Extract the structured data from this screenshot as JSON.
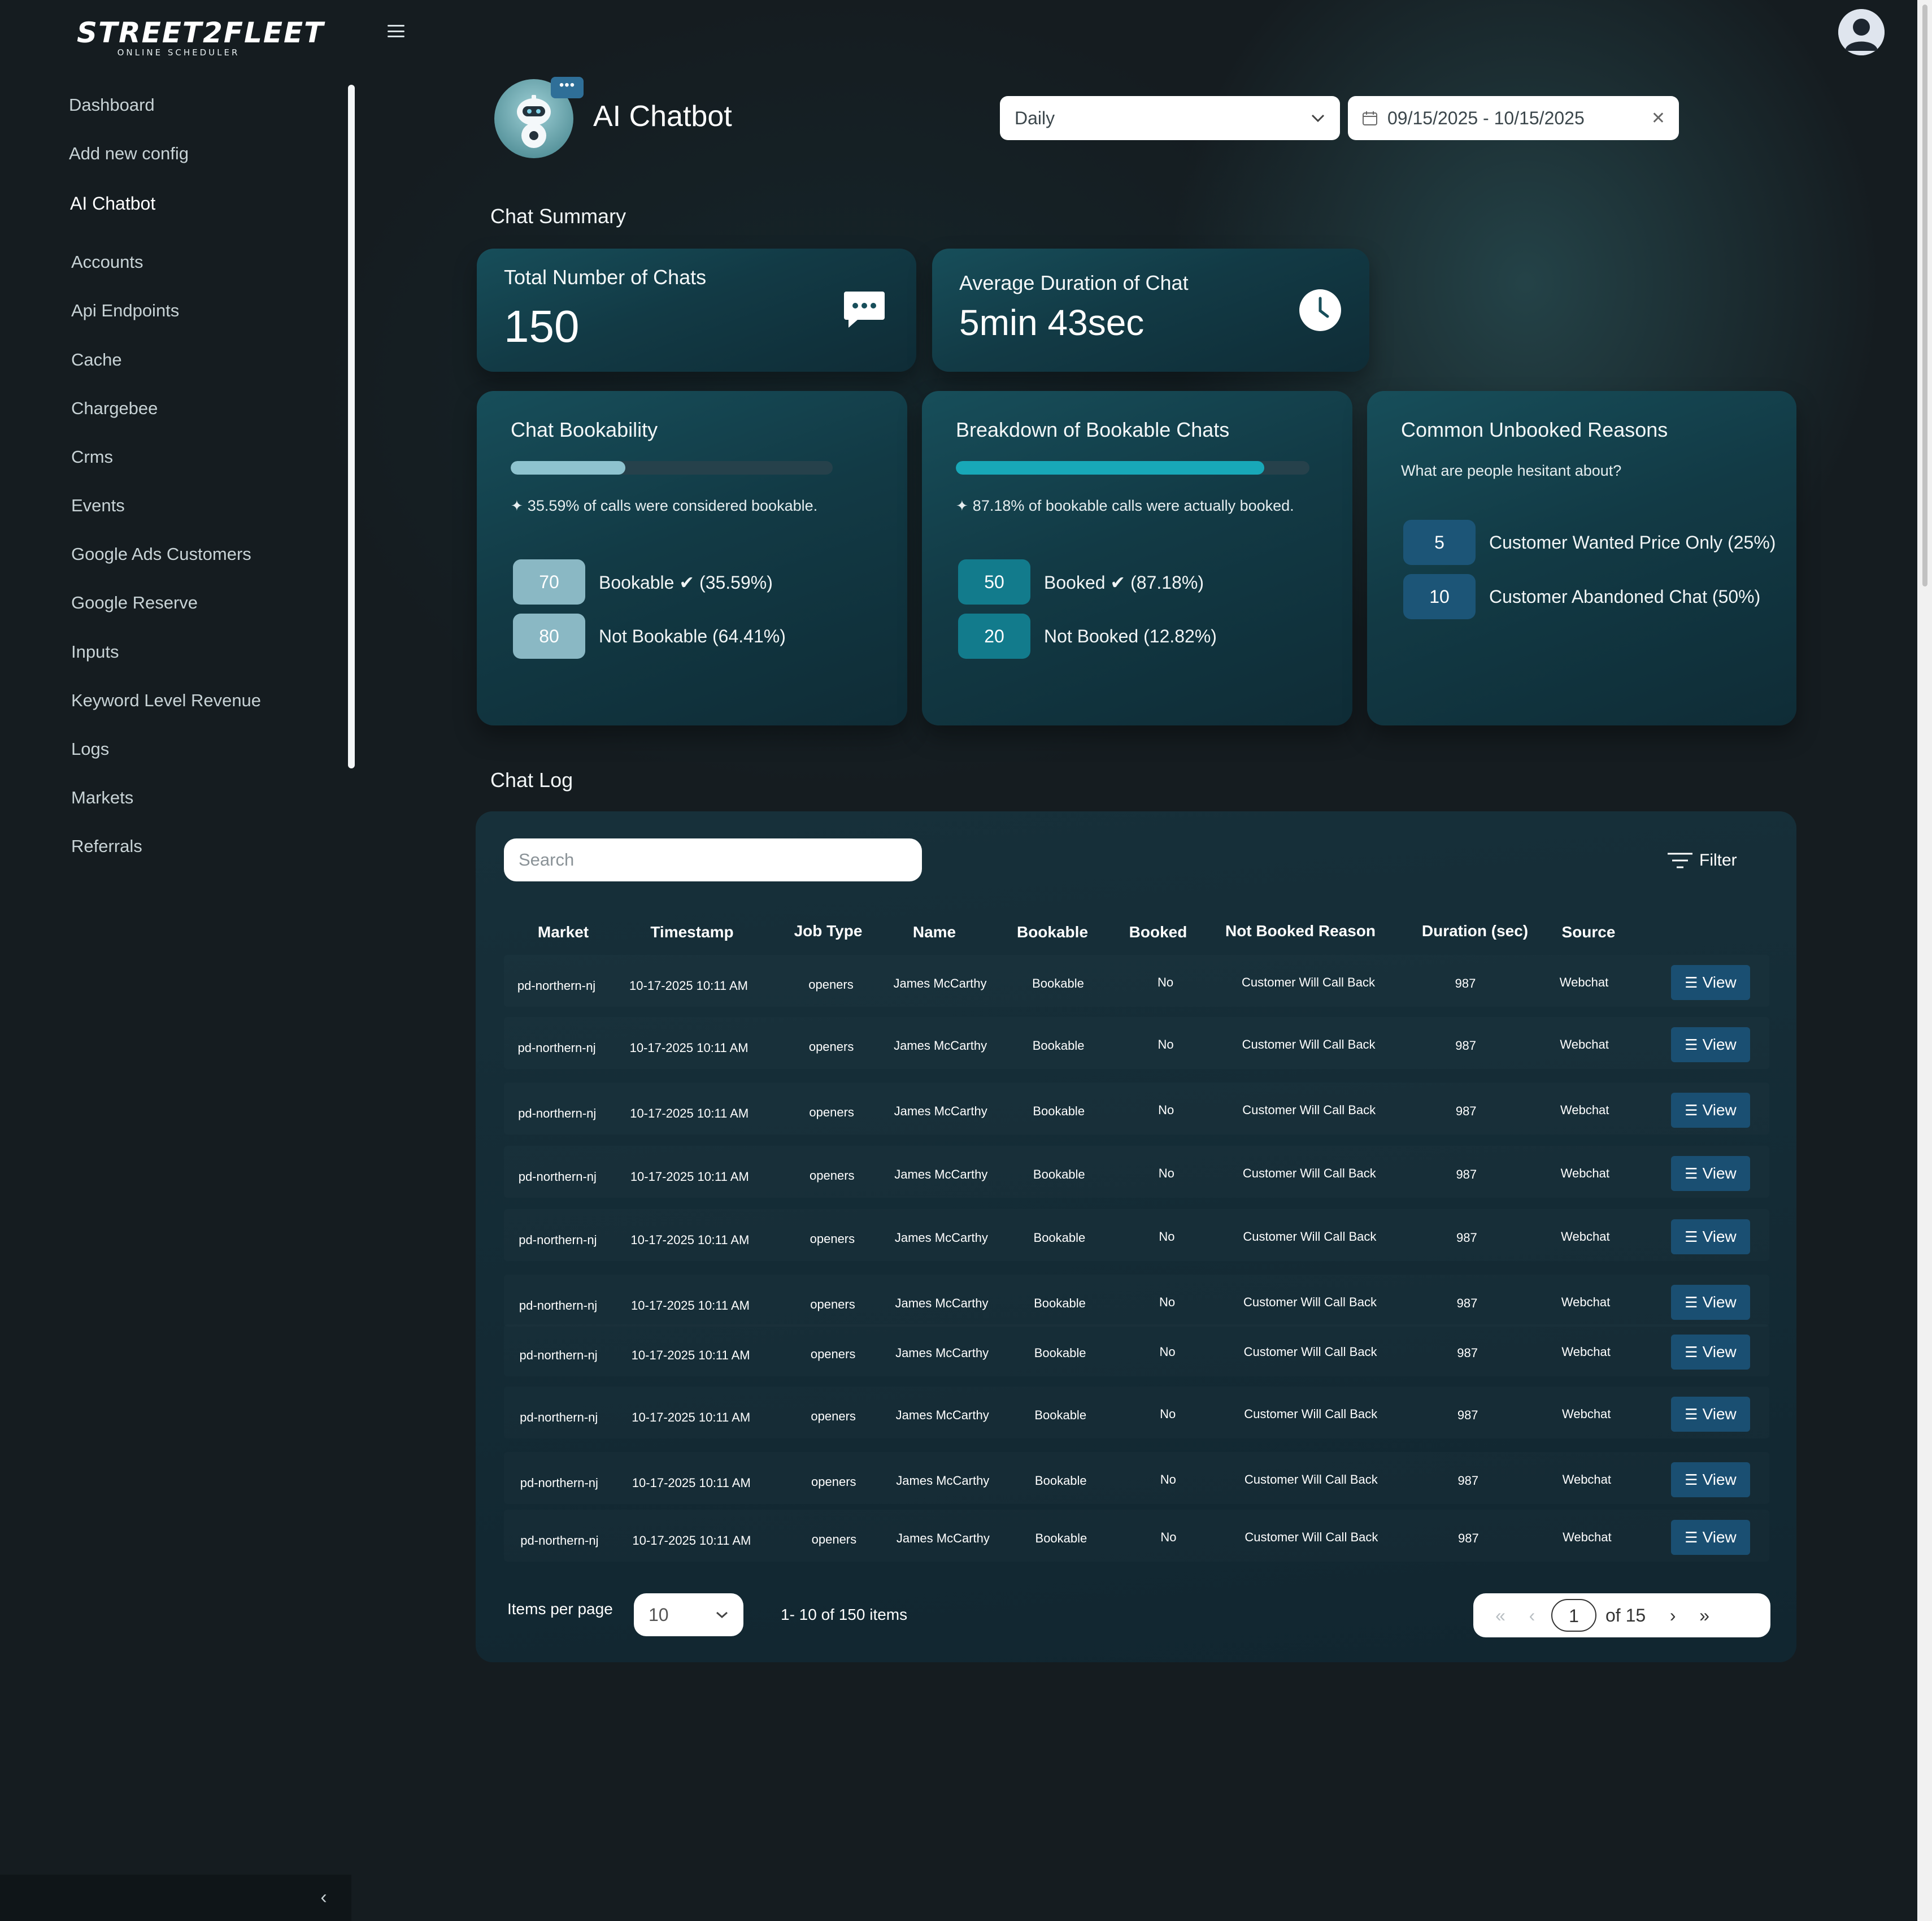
{
  "brand": {
    "name": "STREET2FLEET",
    "tagline": "ONLINE SCHEDULER"
  },
  "sidebar": {
    "items": [
      {
        "label": "Dashboard"
      },
      {
        "label": "Add new config"
      },
      {
        "label": "AI Chatbot"
      },
      {
        "label": "Accounts"
      },
      {
        "label": "Api Endpoints"
      },
      {
        "label": "Cache"
      },
      {
        "label": "Chargebee"
      },
      {
        "label": "Crms"
      },
      {
        "label": "Events"
      },
      {
        "label": "Google Ads Customers"
      },
      {
        "label": "Google Reserve"
      },
      {
        "label": "Inputs"
      },
      {
        "label": "Keyword Level Revenue"
      },
      {
        "label": "Logs"
      },
      {
        "label": "Markets"
      },
      {
        "label": "Referrals"
      }
    ],
    "active": "AI Chatbot"
  },
  "header": {
    "title": "AI Chatbot",
    "period": "Daily",
    "date_range": "09/15/2025 - 10/15/2025"
  },
  "summary": {
    "title": "Chat Summary",
    "total_label": "Total Number of Chats",
    "total_value": "150",
    "duration_label": "Average Duration of Chat",
    "duration_value": "5min 43sec"
  },
  "bookability": {
    "title": "Chat Bookability",
    "progress": 0.3559,
    "hint": "35.59% of calls were considered bookable.",
    "rows": [
      {
        "count": "70",
        "label": "Bookable ✔ (35.59%)"
      },
      {
        "count": "80",
        "label": "Not Bookable (64.41%)"
      }
    ]
  },
  "breakdown": {
    "title": "Breakdown of Bookable Chats",
    "progress": 0.8718,
    "hint": "87.18% of bookable calls were actually booked.",
    "rows": [
      {
        "count": "50",
        "label": "Booked ✔ (87.18%)"
      },
      {
        "count": "20",
        "label": "Not Booked (12.82%)"
      }
    ]
  },
  "unbooked": {
    "title": "Common Unbooked Reasons",
    "subtitle": "What are people hesitant about?",
    "rows": [
      {
        "count": "5",
        "label": "Customer Wanted Price Only (25%)"
      },
      {
        "count": "10",
        "label": "Customer Abandoned Chat (50%)"
      }
    ]
  },
  "chat_log": {
    "title": "Chat Log",
    "search_placeholder": "Search",
    "filter_label": "Filter",
    "columns": [
      "Market",
      "Timestamp",
      "Job Type",
      "Name",
      "Bookable",
      "Booked",
      "Not Booked Reason",
      "Duration (sec)",
      "Source"
    ],
    "view_label": "View",
    "rows": [
      [
        "pd-northern-nj",
        "10-17-2025 10:11 AM",
        "openers",
        "James McCarthy",
        "Bookable",
        "No",
        "Customer Will Call Back",
        "987",
        "Webchat"
      ],
      [
        "pd-northern-nj",
        "10-17-2025 10:11 AM",
        "openers",
        "James McCarthy",
        "Bookable",
        "No",
        "Customer Will Call Back",
        "987",
        "Webchat"
      ],
      [
        "pd-northern-nj",
        "10-17-2025 10:11 AM",
        "openers",
        "James McCarthy",
        "Bookable",
        "No",
        "Customer Will Call Back",
        "987",
        "Webchat"
      ],
      [
        "pd-northern-nj",
        "10-17-2025 10:11 AM",
        "openers",
        "James McCarthy",
        "Bookable",
        "No",
        "Customer Will Call Back",
        "987",
        "Webchat"
      ],
      [
        "pd-northern-nj",
        "10-17-2025 10:11 AM",
        "openers",
        "James McCarthy",
        "Bookable",
        "No",
        "Customer Will Call Back",
        "987",
        "Webchat"
      ],
      [
        "pd-northern-nj",
        "10-17-2025 10:11 AM",
        "openers",
        "James McCarthy",
        "Bookable",
        "No",
        "Customer Will Call Back",
        "987",
        "Webchat"
      ],
      [
        "pd-northern-nj",
        "10-17-2025 10:11 AM",
        "openers",
        "James McCarthy",
        "Bookable",
        "No",
        "Customer Will Call Back",
        "987",
        "Webchat"
      ],
      [
        "pd-northern-nj",
        "10-17-2025 10:11 AM",
        "openers",
        "James McCarthy",
        "Bookable",
        "No",
        "Customer Will Call Back",
        "987",
        "Webchat"
      ],
      [
        "pd-northern-nj",
        "10-17-2025 10:11 AM",
        "openers",
        "James McCarthy",
        "Bookable",
        "No",
        "Customer Will Call Back",
        "987",
        "Webchat"
      ],
      [
        "pd-northern-nj",
        "10-17-2025 10:11 AM",
        "openers",
        "James McCarthy",
        "Bookable",
        "No",
        "Customer Will Call Back",
        "987",
        "Webchat"
      ]
    ],
    "items_per_page_label": "Items per page",
    "items_per_page": "10",
    "range_text": "1- 10 of 150 items",
    "current_page": "1",
    "of_pages": "of 15"
  },
  "icons": {
    "menu": "hamburger-icon",
    "profile": "user-avatar-icon",
    "chats": "chat-bubble-icon",
    "duration": "clock-icon",
    "calendar": "calendar-icon",
    "filter": "filter-icon",
    "sparkle": "sparkle-icon",
    "view": "list-icon"
  },
  "colors": {
    "background": "#151c20",
    "card": "#174e5a",
    "bookable_fill": "#8ec3cf",
    "breakdown_fill": "#18a8b8",
    "pill_light": "#8ab8c4",
    "pill_teal": "#127b8c",
    "pill_blue": "#1c5577",
    "view_button": "#1a4f72"
  }
}
